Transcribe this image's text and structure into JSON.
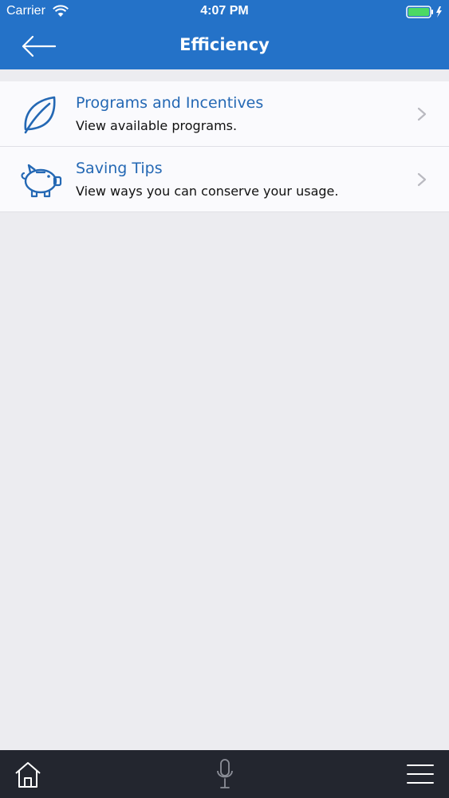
{
  "status_bar": {
    "carrier": "Carrier",
    "time": "4:07 PM",
    "battery_color": "#4cd964"
  },
  "nav": {
    "title": "Efficiency",
    "back_icon": "arrow-left-icon"
  },
  "list": {
    "items": [
      {
        "icon": "leaf-icon",
        "title": "Programs and Incentives",
        "subtitle": "View available programs."
      },
      {
        "icon": "piggy-bank-icon",
        "title": "Saving Tips",
        "subtitle": "View ways you can conserve your usage."
      }
    ]
  },
  "tab_bar": {
    "items": [
      {
        "icon": "home-icon"
      },
      {
        "icon": "microphone-icon"
      },
      {
        "icon": "hamburger-menu-icon"
      }
    ]
  },
  "colors": {
    "header": "#2472c8",
    "accent_text": "#2468b4",
    "background": "#ececf0",
    "tab_bar": "#23262f"
  }
}
